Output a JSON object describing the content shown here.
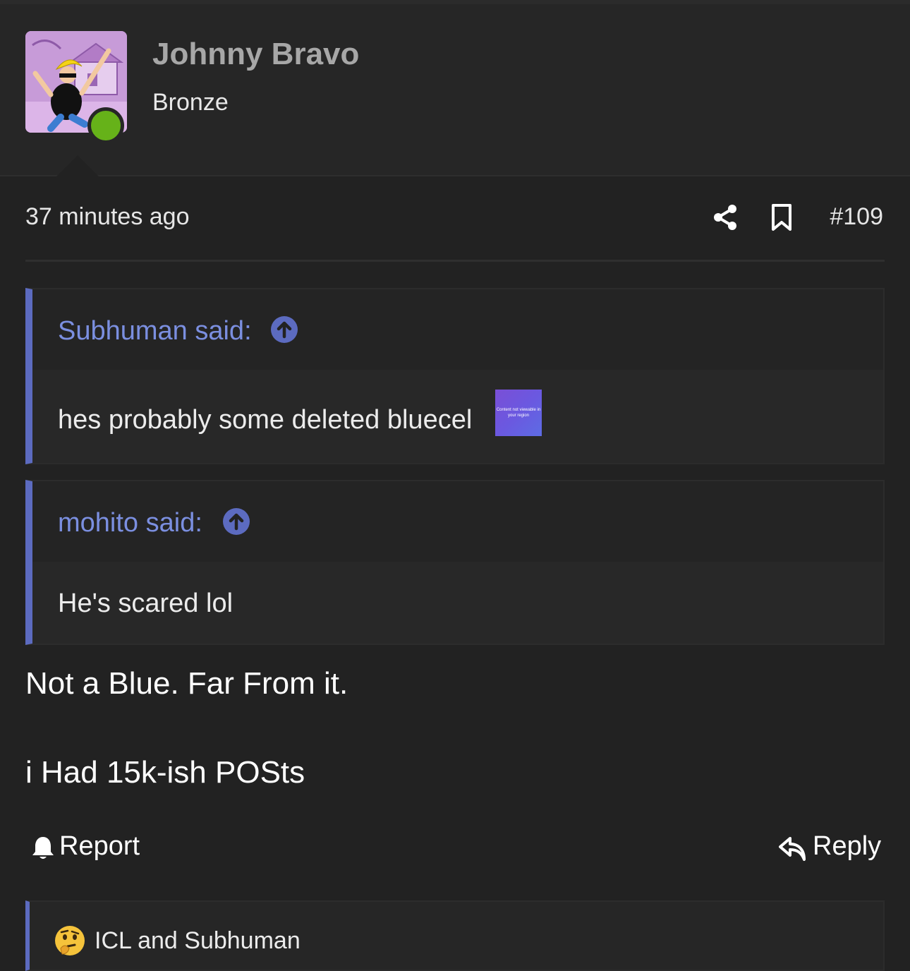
{
  "user": {
    "name": "Johnny Bravo",
    "rank": "Bronze"
  },
  "post": {
    "timestamp": "37 minutes ago",
    "number": "#109",
    "quotes": [
      {
        "author": "Subhuman said:",
        "text": "hes probably some deleted bluecel",
        "image_text": "Content not viewable in your region"
      },
      {
        "author": "mohito said:",
        "text": "He's scared lol"
      }
    ],
    "lines": [
      "Not a Blue. Far From it.",
      "i Had 15k-ish POSts"
    ]
  },
  "actions": {
    "report_label": "Report",
    "reply_label": "Reply"
  },
  "reactions": {
    "text": "ICL and Subhuman"
  },
  "colors": {
    "background": "#222222",
    "accent": "#5c6bc0",
    "quote_author": "#7b8fe0",
    "online": "#66b219"
  },
  "icons": [
    "share-icon",
    "bookmark-icon",
    "arrow-up-circle-icon",
    "bell-icon",
    "reply-icon",
    "thinking-face-icon"
  ]
}
